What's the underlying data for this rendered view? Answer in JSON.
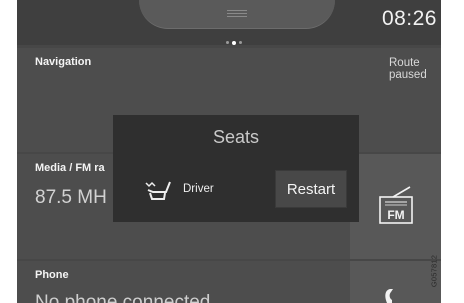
{
  "status_bar": {
    "clock": "08:26"
  },
  "navigation": {
    "label": "Navigation",
    "route_status": "Route paused"
  },
  "media": {
    "label": "Media / FM ra",
    "frequency": "87.5 MH",
    "fm_icon": "fm-radio-icon",
    "fm_text": "FM"
  },
  "phone": {
    "label": "Phone",
    "status": "No phone connected",
    "icon": "phone-icon"
  },
  "modal": {
    "title": "Seats",
    "item_label": "Driver",
    "seat_icon": "seat-massage-icon",
    "button_label": "Restart"
  },
  "figure_code": "G057812",
  "colors": {
    "screen_bg": "#474747",
    "tile_bg": "#4d4d4d",
    "modal_bg": "#2f2f2f",
    "button_bg": "#484848"
  }
}
